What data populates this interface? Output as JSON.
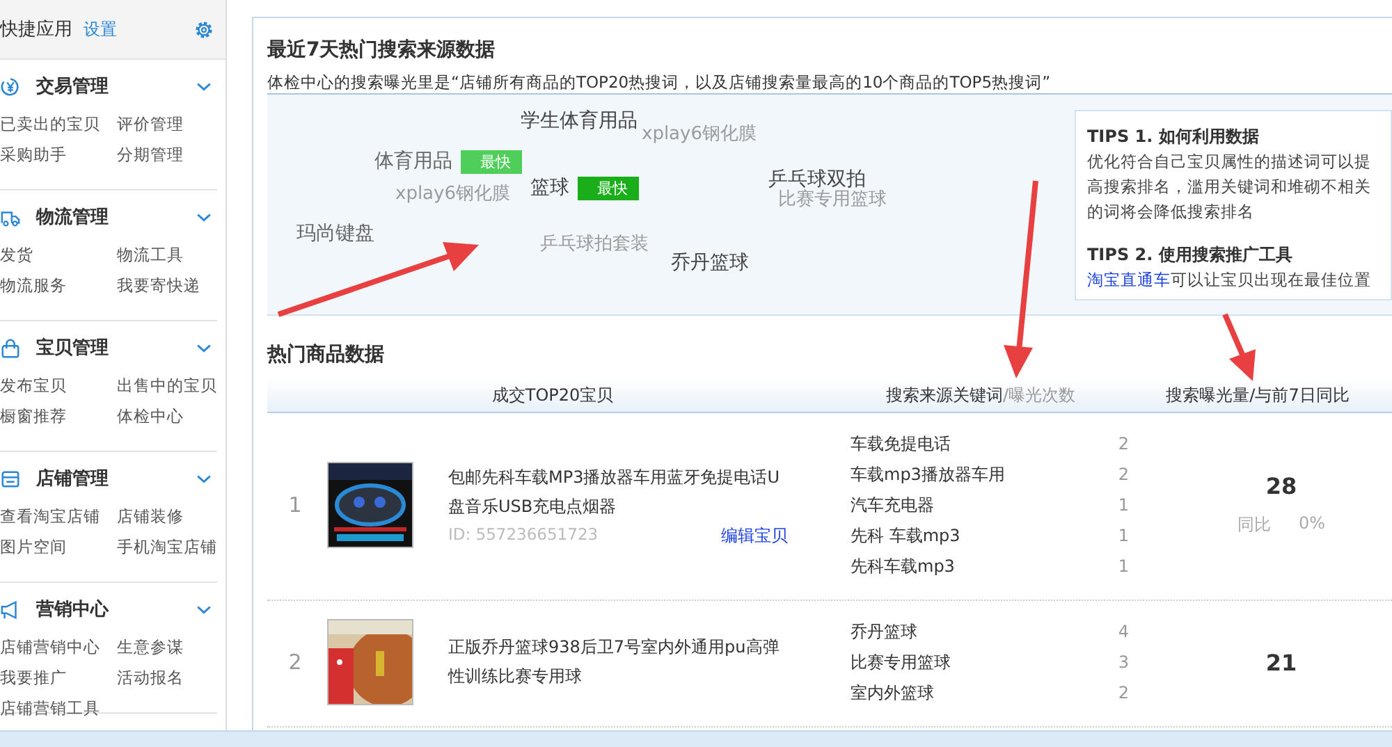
{
  "sidebar": {
    "title": "快捷应用",
    "settings_link": "设置",
    "sections": [
      {
        "title": "交易管理",
        "expanded": true,
        "items": [
          "已卖出的宝贝",
          "评价管理",
          "采购助手",
          "分期管理"
        ]
      },
      {
        "title": "物流管理",
        "expanded": true,
        "items": [
          "发货",
          "物流工具",
          "物流服务",
          "我要寄快递"
        ]
      },
      {
        "title": "宝贝管理",
        "expanded": true,
        "items": [
          "发布宝贝",
          "出售中的宝贝",
          "橱窗推荐",
          "体检中心"
        ]
      },
      {
        "title": "店铺管理",
        "expanded": true,
        "items": [
          "查看淘宝店铺",
          "店铺装修",
          "图片空间",
          "手机淘宝店铺"
        ]
      },
      {
        "title": "营销中心",
        "expanded": true,
        "items": [
          "店铺营销中心",
          "生意参谋",
          "我要推广",
          "活动报名",
          "店铺营销工具"
        ]
      }
    ]
  },
  "search_source": {
    "title": "最近7天热门搜索来源数据",
    "description": "体检中心的搜索曝光里是“店铺所有商品的TOP20热搜词，以及店铺搜索量最高的10个商品的TOP5热搜词”",
    "words": [
      {
        "text": "学生体育用品",
        "kind": "strong"
      },
      {
        "text": "xplay6钢化膜",
        "kind": "faint"
      },
      {
        "text": "体育用品",
        "kind": "normal",
        "badge": "最快",
        "color": "#4fcf5a"
      },
      {
        "text": "xplay6钢化膜",
        "kind": "faint"
      },
      {
        "text": "篮球",
        "kind": "strong",
        "badge": "最快",
        "color": "#1aaf1a"
      },
      {
        "text": "乒乓球双拍",
        "kind": "strong"
      },
      {
        "text": "比赛专用篮球",
        "kind": "faint"
      },
      {
        "text": "玛尚键盘",
        "kind": "normal"
      },
      {
        "text": "乒乓球拍套装",
        "kind": "faint"
      },
      {
        "text": "乔丹篮球",
        "kind": "strong"
      }
    ],
    "tips": [
      {
        "title": "TIPS 1. 如何利用数据",
        "body": "优化符合自己宝贝属性的描述词可以提高搜索排名，滥用关键词和堆砌不相关的词将会降低搜索排名"
      },
      {
        "title": "TIPS 2. 使用搜索推广工具",
        "link": "淘宝直通车",
        "body": "可以让宝贝出现在最佳位置"
      }
    ]
  },
  "hot_items": {
    "title": "热门商品数据",
    "columns": {
      "product": "成交TOP20宝贝",
      "keywords": "搜索来源关键词",
      "keywords_sub": "/曝光次数",
      "exposure": "搜索曝光量/与前7日同比"
    },
    "rows": [
      {
        "rank": "1",
        "title": "包邮先科车载MP3播放器车用蓝牙免提电话U盘音乐USB充电点烟器",
        "id": "ID: 557236651723",
        "edit_link": "编辑宝贝",
        "keywords": [
          {
            "word": "车载免提电话",
            "count": "2"
          },
          {
            "word": "车载mp3播放器车用",
            "count": "2"
          },
          {
            "word": "汽车充电器",
            "count": "1"
          },
          {
            "word": "先科 车载mp3",
            "count": "1"
          },
          {
            "word": "先科车载mp3",
            "count": "1"
          }
        ],
        "exposure": "28",
        "compare_label": "同比",
        "compare": "0%"
      },
      {
        "rank": "2",
        "title": "正版乔丹篮球938后卫7号室内外通用pu高弹性训练比赛专用球",
        "keywords": [
          {
            "word": "乔丹篮球",
            "count": "4"
          },
          {
            "word": "比赛专用篮球",
            "count": "3"
          },
          {
            "word": "室内外篮球",
            "count": "2"
          }
        ],
        "exposure": "21"
      }
    ]
  }
}
